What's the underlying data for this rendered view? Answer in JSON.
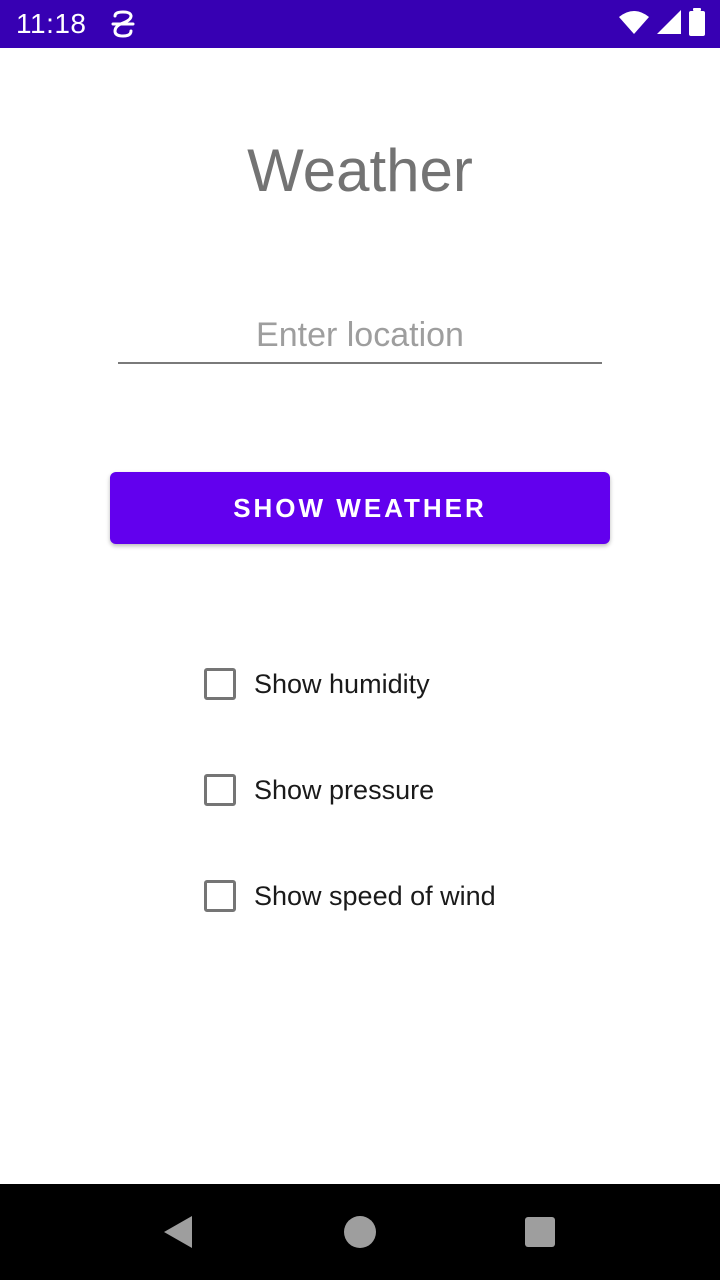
{
  "status_bar": {
    "time": "11:18",
    "background_color": "#3700b3",
    "icons": [
      "app-notification-icon",
      "wifi-icon",
      "signal-icon",
      "battery-icon"
    ]
  },
  "title": "Weather",
  "location_input": {
    "value": "",
    "placeholder": "Enter location"
  },
  "show_button": {
    "label": "SHOW WEATHER",
    "color": "#6200ee"
  },
  "options": [
    {
      "label": "Show humidity",
      "checked": false
    },
    {
      "label": "Show pressure",
      "checked": false
    },
    {
      "label": "Show speed of wind",
      "checked": false
    }
  ],
  "nav_bar": {
    "icons": [
      "back-icon",
      "home-icon",
      "recents-icon"
    ]
  }
}
